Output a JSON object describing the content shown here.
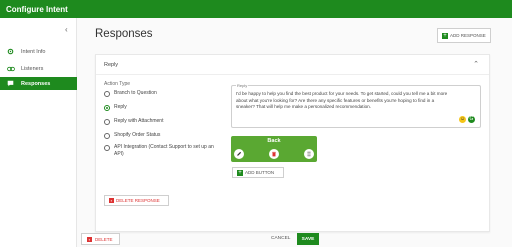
{
  "topbar": {
    "title": "Configure Intent"
  },
  "sidebar": {
    "collapse_glyph": "‹",
    "items": [
      {
        "label": "Intent Info",
        "icon": "gear-icon",
        "active": false
      },
      {
        "label": "Listeners",
        "icon": "link-icon",
        "active": false
      },
      {
        "label": "Responses",
        "icon": "chat-icon",
        "active": true
      }
    ]
  },
  "main": {
    "title": "Responses",
    "add_response_label": "ADD RESPONSE",
    "card": {
      "header": "Reply",
      "action_type_label": "Action Type",
      "options": [
        {
          "label": "Branch to Question",
          "selected": false
        },
        {
          "label": "Reply",
          "selected": true
        },
        {
          "label": "Reply with Attachment",
          "selected": false
        },
        {
          "label": "Shopify Order Status",
          "selected": false
        },
        {
          "label": "API Integration (Contact Support to set up an API)",
          "selected": false
        }
      ],
      "reply_field_label": "Reply",
      "reply_text": "I'd be happy to help you find the best product for your needs. To get started, could you tell me a bit more about what you're looking for? Are there any specific features or benefits you're hoping to find in a sneaker? That will help me make a personalized recommendation.",
      "quick_button": {
        "label": "Back"
      },
      "add_button_label": "ADD BUTTON",
      "delete_response_label": "DELETE RESPONSE"
    }
  },
  "footer": {
    "delete_label": "DELETE",
    "cancel_label": "CANCEL",
    "save_label": "SAVE"
  },
  "colors": {
    "brand": "#1e8a1e",
    "button_card": "#5aa832",
    "danger": "#dd3333"
  }
}
